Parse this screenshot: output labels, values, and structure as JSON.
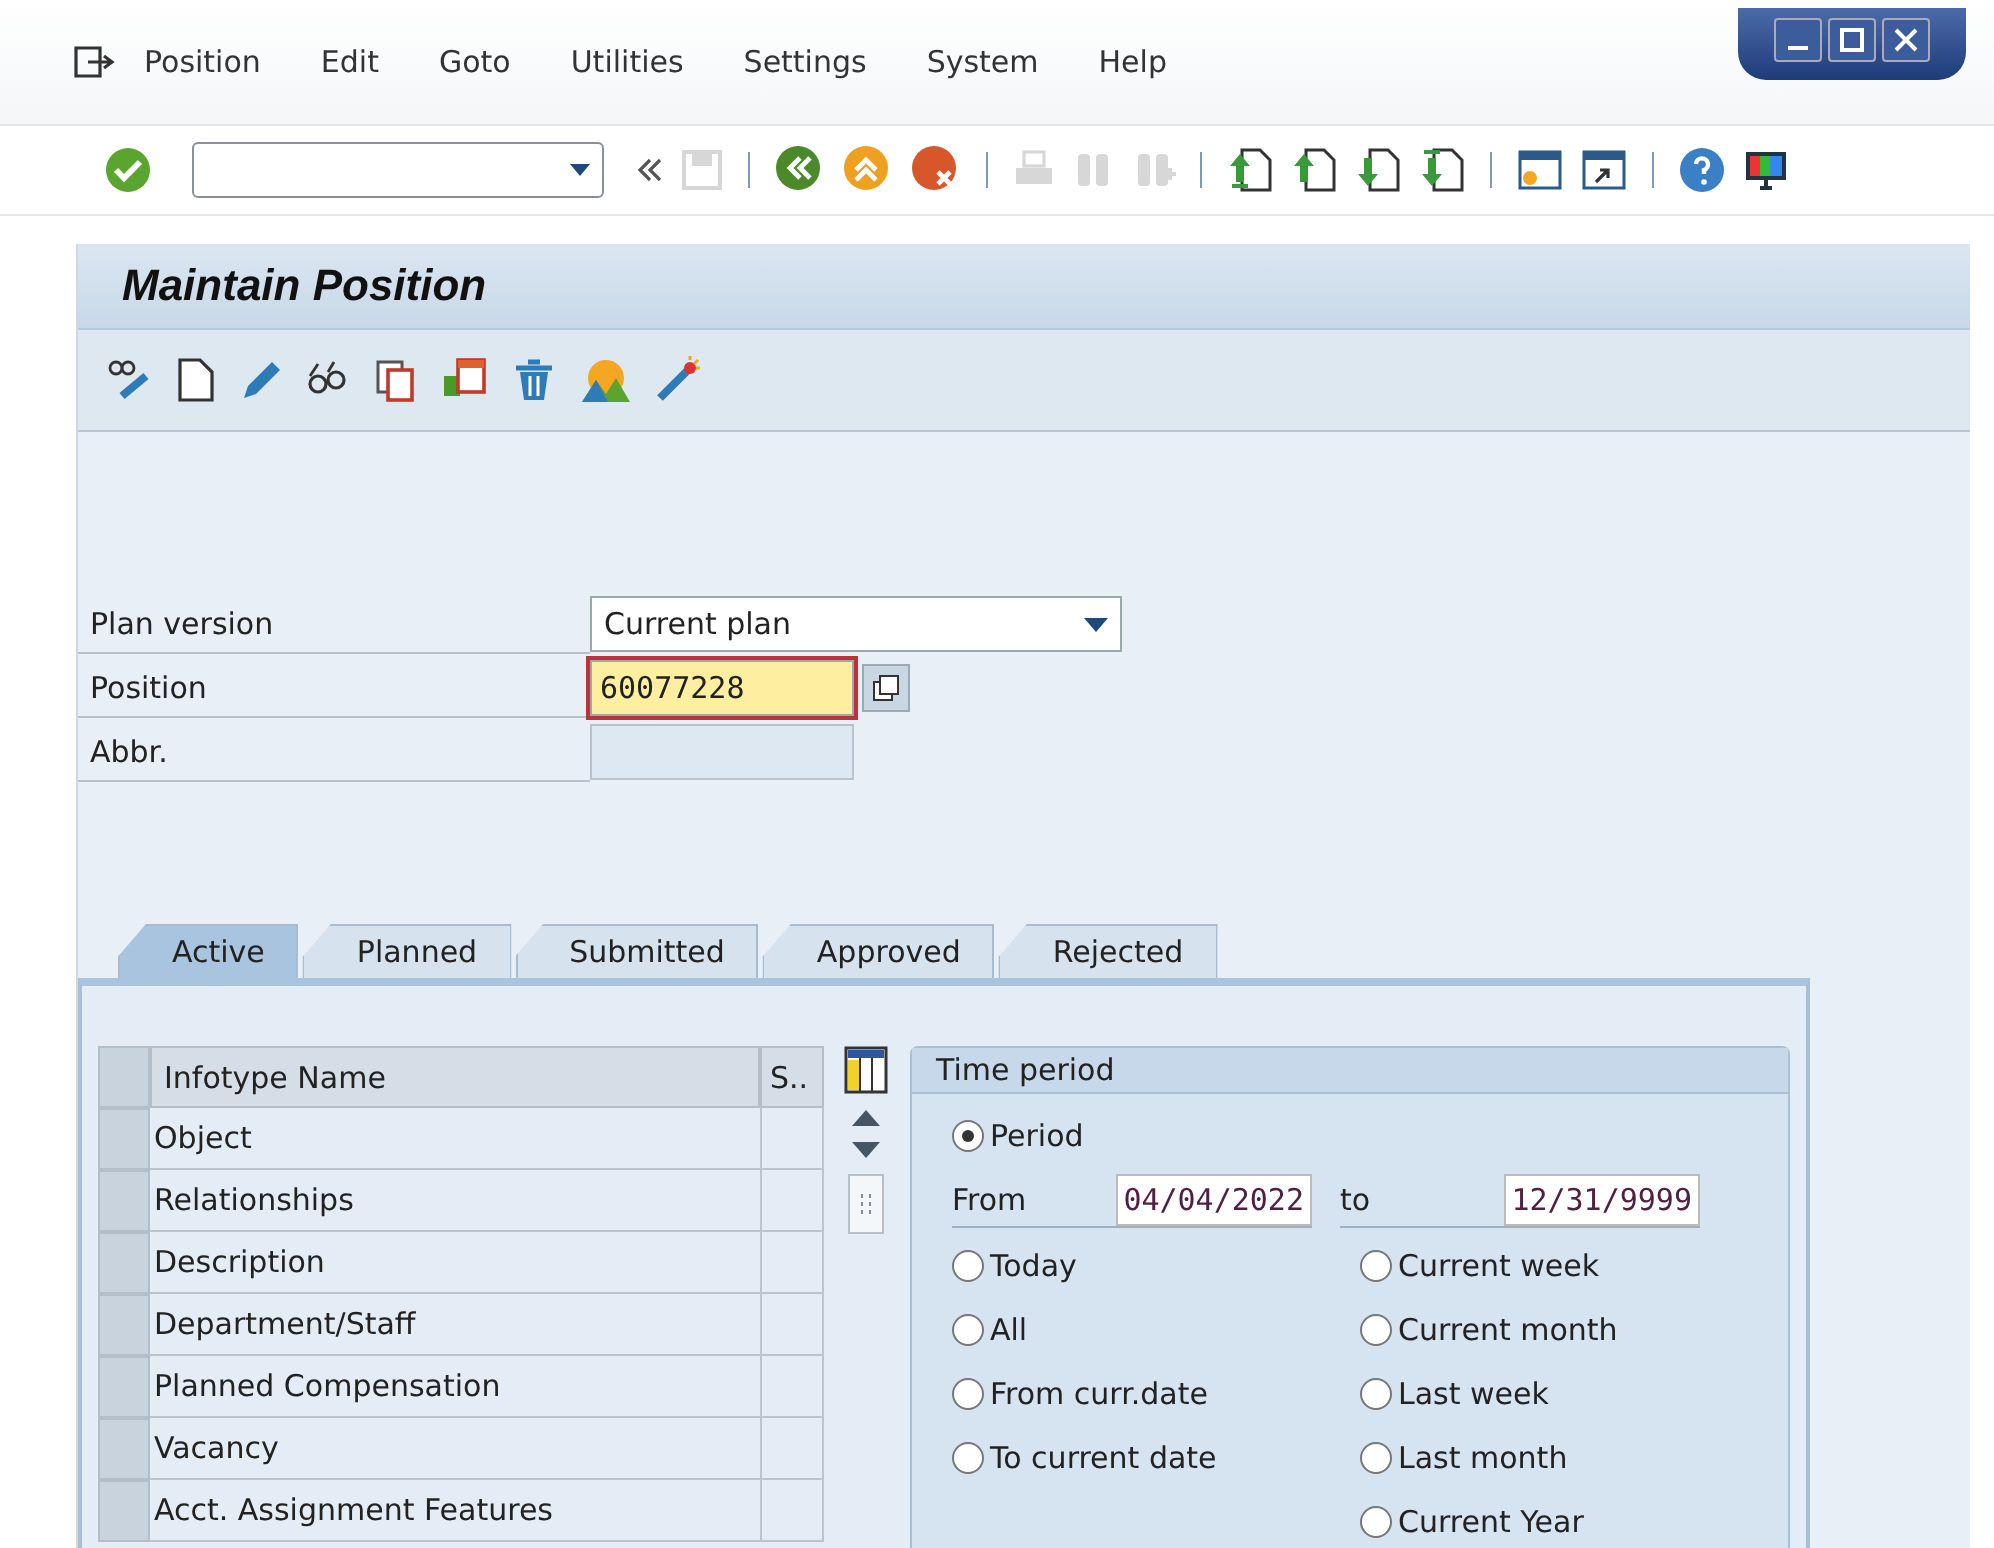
{
  "menu": [
    "Position",
    "Edit",
    "Goto",
    "Utilities",
    "Settings",
    "System",
    "Help"
  ],
  "toolbar": [
    {
      "kind": "enter",
      "disabled": false
    },
    {
      "kind": "command-field",
      "disabled": false
    },
    {
      "kind": "collapse",
      "disabled": false
    },
    {
      "kind": "save",
      "disabled": true
    },
    {
      "kind": "sep"
    },
    {
      "kind": "back",
      "disabled": false
    },
    {
      "kind": "exit",
      "disabled": false
    },
    {
      "kind": "cancel",
      "disabled": false
    },
    {
      "kind": "sep"
    },
    {
      "kind": "print",
      "disabled": true
    },
    {
      "kind": "find",
      "disabled": true
    },
    {
      "kind": "find-next",
      "disabled": true
    },
    {
      "kind": "sep"
    },
    {
      "kind": "first-page",
      "disabled": false
    },
    {
      "kind": "prev-page",
      "disabled": false
    },
    {
      "kind": "next-page",
      "disabled": false
    },
    {
      "kind": "last-page",
      "disabled": false
    },
    {
      "kind": "sep"
    },
    {
      "kind": "new-session",
      "disabled": false
    },
    {
      "kind": "shortcut",
      "disabled": false
    },
    {
      "kind": "sep"
    },
    {
      "kind": "help",
      "disabled": false
    },
    {
      "kind": "layout",
      "disabled": false
    }
  ],
  "title": "Maintain Position",
  "app_toolbar": [
    {
      "kind": "display"
    },
    {
      "kind": "create"
    },
    {
      "kind": "change"
    },
    {
      "kind": "overview"
    },
    {
      "kind": "copy"
    },
    {
      "kind": "delimit"
    },
    {
      "kind": "delete"
    },
    {
      "kind": "structure"
    },
    {
      "kind": "wizard"
    }
  ],
  "fields": [
    {
      "kind": "dropdown",
      "label": "Plan version",
      "value": "Current plan",
      "focused": false
    },
    {
      "kind": "input",
      "label": "Position",
      "value": "60077228",
      "focused": true
    },
    {
      "kind": "readonly",
      "label": "Abbr.",
      "focused": false
    }
  ],
  "tabs": [
    {
      "label": "Active",
      "selected": true
    },
    {
      "label": "Planned",
      "selected": false
    },
    {
      "label": "Submitted",
      "selected": false
    },
    {
      "label": "Approved",
      "selected": false
    },
    {
      "label": "Rejected",
      "selected": false
    }
  ],
  "table": {
    "columns": [
      "Infotype Name",
      "S.."
    ],
    "rows": [
      "Object",
      "Relationships",
      "Description",
      "Department/Staff",
      "Planned Compensation",
      "Vacancy",
      "Acct. Assignment Features"
    ]
  },
  "time_period": {
    "title": "Time period",
    "period": {
      "label": "Period",
      "selected": true
    },
    "from_label": "From",
    "from_value": "04/04/2022",
    "to_label": "to",
    "to_value": "12/31/9999",
    "left_options": [
      {
        "label": "Today",
        "selected": false
      },
      {
        "label": "All",
        "selected": false
      },
      {
        "label": "From curr.date",
        "selected": false
      },
      {
        "label": "To current date",
        "selected": false
      }
    ],
    "right_options": [
      {
        "label": "Current week",
        "selected": false
      },
      {
        "label": "Current month",
        "selected": false
      },
      {
        "label": "Last week",
        "selected": false
      },
      {
        "label": "Last month",
        "selected": false
      },
      {
        "label": "Current Year",
        "selected": false
      }
    ]
  }
}
